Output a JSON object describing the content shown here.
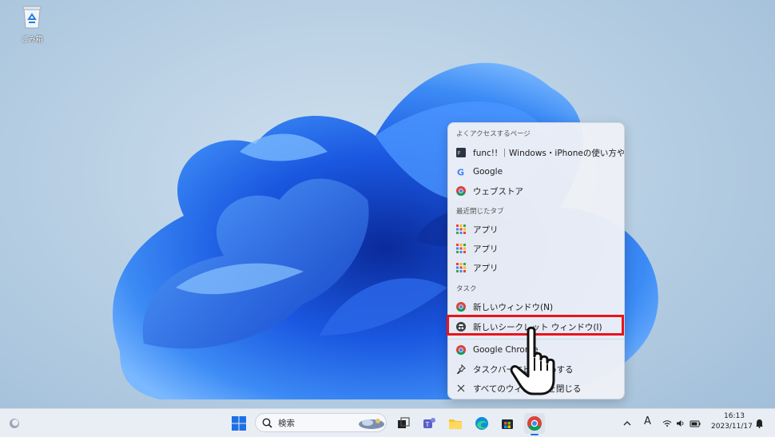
{
  "desktop": {
    "recycle_bin_label": "ごみ箱"
  },
  "jumplist": {
    "sections": [
      {
        "header": "よくアクセスするページ",
        "items": [
          {
            "label": "func!! ｜Windows・iPhoneの使い方や...",
            "icon": "func-site-icon"
          },
          {
            "label": "Google",
            "icon": "google-icon"
          },
          {
            "label": "ウェブストア",
            "icon": "chrome-icon"
          }
        ]
      },
      {
        "header": "最近閉じたタブ",
        "items": [
          {
            "label": "アプリ",
            "icon": "apps-grid-icon"
          },
          {
            "label": "アプリ",
            "icon": "apps-grid-icon"
          },
          {
            "label": "アプリ",
            "icon": "apps-grid-icon"
          }
        ]
      },
      {
        "header": "タスク",
        "items": [
          {
            "label": "新しいウィンドウ(N)",
            "icon": "chrome-icon"
          },
          {
            "label": "新しいシークレット ウィンドウ(I)",
            "icon": "incognito-icon"
          }
        ]
      }
    ],
    "footer": [
      {
        "label": "Google Chrome",
        "icon": "chrome-icon"
      },
      {
        "label": "タスクバーにピン留めする",
        "icon": "pin-icon"
      },
      {
        "label": "すべてのウィンドウを閉じる",
        "icon": "close-icon"
      }
    ]
  },
  "taskbar": {
    "search_placeholder": "検索",
    "ime_indicator": "A",
    "time": "16:13",
    "date": "2023/11/17"
  },
  "colors": {
    "highlight": "#e8141b",
    "accent": "#1f6fe5"
  }
}
